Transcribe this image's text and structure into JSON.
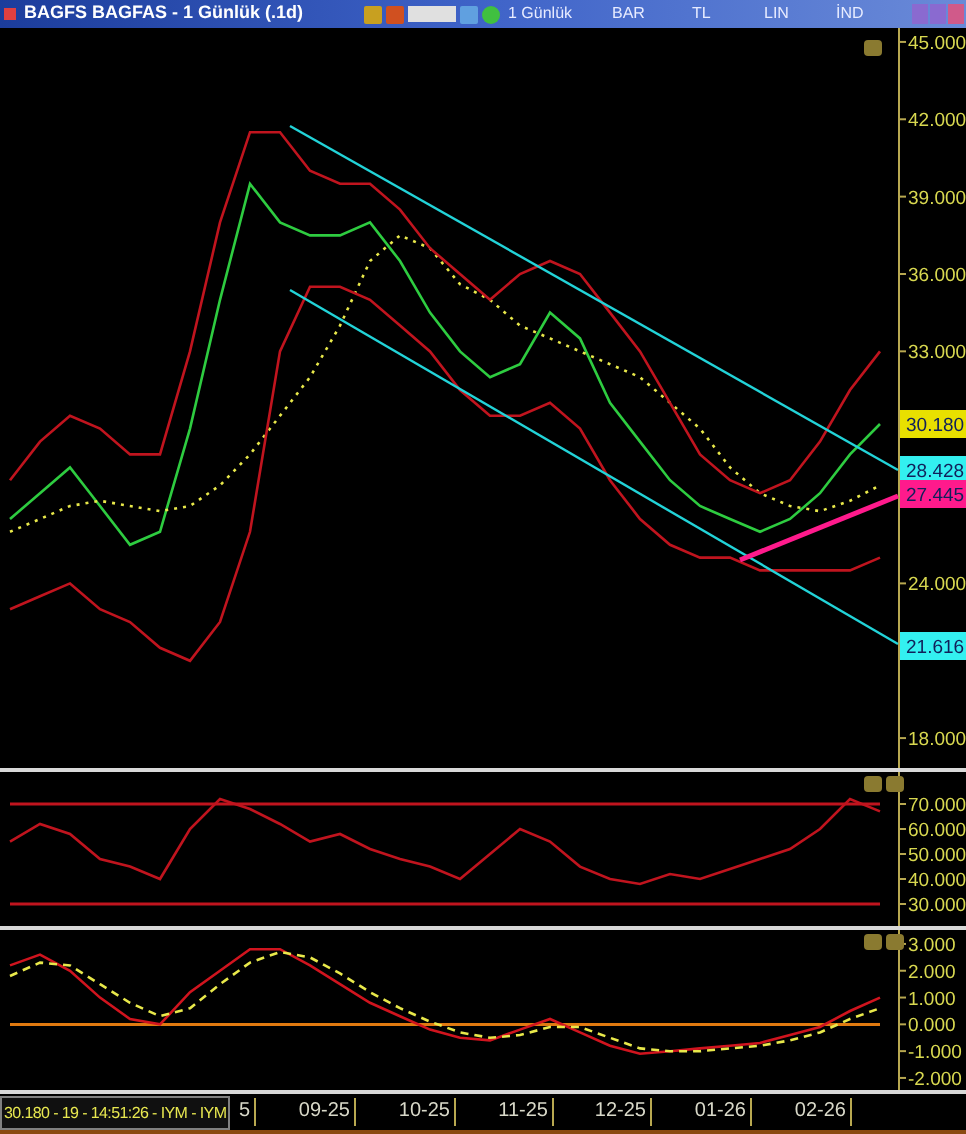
{
  "title_bar": {
    "title": "BAGFS BAGFAS - 1 Günlük (.1d)",
    "toolbar": [
      {
        "label": "1 Günlük"
      },
      {
        "label": "BAR"
      },
      {
        "label": "TL"
      },
      {
        "label": "LIN"
      },
      {
        "label": "İND"
      }
    ]
  },
  "price_panel": {
    "chart_data": {
      "type": "line",
      "ylim": [
        16.84,
        45.54
      ],
      "yticks": [
        {
          "value": 45,
          "label": "45.000"
        },
        {
          "value": 42,
          "label": "42.000"
        },
        {
          "value": 39,
          "label": "39.000"
        },
        {
          "value": 36,
          "label": "36.000"
        },
        {
          "value": 33,
          "label": "33.000"
        },
        {
          "value": 24,
          "label": "24.000"
        },
        {
          "value": 18,
          "label": "18.000"
        }
      ],
      "series": [
        {
          "color": "#2ecc40",
          "values": [
            26.5,
            27.5,
            28.5,
            27,
            25.5,
            26,
            30,
            35,
            39.5,
            38,
            37.5,
            37.5,
            38,
            36.5,
            34.5,
            33,
            32,
            32.5,
            34.5,
            33.5,
            31,
            29.5,
            28,
            27,
            26.5,
            26,
            26.5,
            27.5,
            29,
            30.18
          ]
        },
        {
          "color": "#e8e84a",
          "line_style": "dotted",
          "values": [
            26,
            26.5,
            27,
            27.2,
            27,
            26.8,
            27,
            27.8,
            29,
            30.5,
            32,
            34,
            36.5,
            37.5,
            37,
            35.6,
            35,
            34,
            33.5,
            33,
            32.5,
            32,
            31,
            30,
            28.5,
            27.5,
            27,
            26.8,
            27.2,
            27.8
          ]
        },
        {
          "color": "#c0141e",
          "values": [
            28,
            29.5,
            30.5,
            30,
            29,
            29,
            33,
            38,
            41.5,
            41.5,
            40,
            39.5,
            39.5,
            38.5,
            37,
            36,
            35,
            36,
            36.5,
            36,
            34.5,
            33,
            31,
            29,
            28,
            27.5,
            28,
            29.5,
            31.5,
            33
          ]
        },
        {
          "color": "#c0141e",
          "values": [
            23,
            23.5,
            24,
            23,
            22.5,
            21.5,
            21,
            22.5,
            26,
            33,
            35.5,
            35.5,
            35,
            34,
            33,
            31.5,
            30.5,
            30.5,
            31,
            30,
            28,
            26.5,
            25.5,
            25,
            25,
            24.5,
            24.5,
            24.5,
            24.5,
            25
          ]
        }
      ]
    },
    "price_tags": [
      {
        "text": "30.180",
        "color": "#e8e000"
      },
      {
        "text": "28.428",
        "color": "#33f0f0"
      },
      {
        "text": "27.445",
        "color": "#ff1a8c"
      },
      {
        "text": "21.616",
        "color": "#33f0f0"
      }
    ]
  },
  "rsi_panel": {
    "chart_data": {
      "type": "line",
      "ylim": [
        21.2,
        82.8
      ],
      "yticks": [
        {
          "value": 70,
          "label": "70.000"
        },
        {
          "value": 60,
          "label": "60.000"
        },
        {
          "value": 50,
          "label": "50.000"
        },
        {
          "value": 40,
          "label": "40.000"
        },
        {
          "value": 30,
          "label": "30.000"
        }
      ],
      "series": [
        {
          "color": "#c0141e",
          "values": [
            70,
            70,
            70,
            70,
            70,
            70,
            70,
            70,
            70,
            70,
            70,
            70,
            70,
            70,
            70,
            70,
            70,
            70,
            70,
            70,
            70,
            70,
            70,
            70,
            70,
            70,
            70,
            70,
            70,
            70
          ]
        },
        {
          "color": "#c0141e",
          "values": [
            30,
            30,
            30,
            30,
            30,
            30,
            30,
            30,
            30,
            30,
            30,
            30,
            30,
            30,
            30,
            30,
            30,
            30,
            30,
            30,
            30,
            30,
            30,
            30,
            30,
            30,
            30,
            30,
            30,
            30
          ]
        },
        {
          "color": "#c0141e",
          "values": [
            55,
            62,
            58,
            48,
            45,
            40,
            60,
            72,
            68,
            62,
            55,
            58,
            52,
            48,
            45,
            40,
            50,
            60,
            55,
            45,
            40,
            38,
            42,
            40,
            44,
            48,
            52,
            60,
            72,
            67
          ]
        }
      ]
    }
  },
  "macd_panel": {
    "chart_data": {
      "type": "line",
      "ylim": [
        -2.45,
        3.52
      ],
      "yticks": [
        {
          "value": 3,
          "label": "3.000"
        },
        {
          "value": 2,
          "label": "2.000"
        },
        {
          "value": 1,
          "label": "1.000"
        },
        {
          "value": 0,
          "label": "0.000"
        },
        {
          "value": -1,
          "label": "-1.000"
        },
        {
          "value": -2,
          "label": "-2.000"
        }
      ],
      "series": [
        {
          "color": "#e07a10",
          "values": [
            0,
            0,
            0,
            0,
            0,
            0,
            0,
            0,
            0,
            0,
            0,
            0,
            0,
            0,
            0,
            0,
            0,
            0,
            0,
            0,
            0,
            0,
            0,
            0,
            0,
            0,
            0,
            0,
            0,
            0
          ]
        },
        {
          "color": "#d0141e",
          "values": [
            2.2,
            2.6,
            2.0,
            1.0,
            0.2,
            0.0,
            1.2,
            2.0,
            2.8,
            2.8,
            2.2,
            1.5,
            0.8,
            0.3,
            -0.2,
            -0.5,
            -0.6,
            -0.2,
            0.2,
            -0.3,
            -0.8,
            -1.1,
            -1.0,
            -0.9,
            -0.8,
            -0.7,
            -0.4,
            -0.1,
            0.5,
            1.0
          ]
        },
        {
          "color": "#e8e84a",
          "line_style": "dashed",
          "values": [
            1.8,
            2.3,
            2.2,
            1.5,
            0.8,
            0.3,
            0.6,
            1.5,
            2.3,
            2.7,
            2.5,
            1.9,
            1.2,
            0.6,
            0.1,
            -0.3,
            -0.5,
            -0.4,
            -0.1,
            -0.1,
            -0.5,
            -0.9,
            -1.0,
            -1.0,
            -0.9,
            -0.8,
            -0.6,
            -0.3,
            0.2,
            0.6
          ]
        }
      ]
    }
  },
  "time_axis": {
    "status": "30.180 - 19 - 14:51:26 - IYM - IYM",
    "labels": [
      "5",
      "09-25",
      "10-25",
      "11-25",
      "12-25",
      "01-26",
      "02-26"
    ]
  }
}
